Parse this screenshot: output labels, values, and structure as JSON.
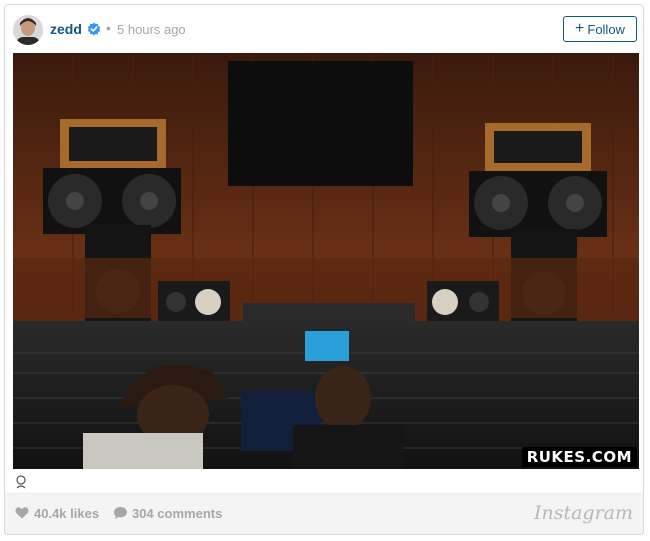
{
  "post": {
    "username": "zedd",
    "separator": "•",
    "timestamp": "5 hours ago",
    "follow_label": "Follow"
  },
  "photo": {
    "watermark": "RUKES.COM"
  },
  "footer": {
    "likes": "40.4k likes",
    "comments": "304 comments",
    "brand": "Instagram"
  },
  "colors": {
    "username": "#125688",
    "verified_badge": "#3897f0",
    "muted_text": "#a5a7aa"
  },
  "icons": [
    "avatar",
    "verified-badge-icon",
    "plus-icon",
    "caption-icon",
    "heart-icon",
    "comment-icon"
  ]
}
